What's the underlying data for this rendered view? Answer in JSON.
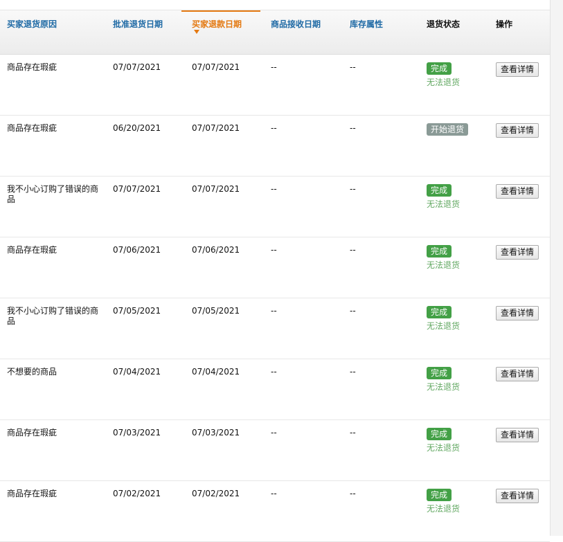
{
  "columns": {
    "reason": "买家退货原因",
    "approve_date": "批准退货日期",
    "refund_date": "买家退款日期",
    "receive_date": "商品接收日期",
    "stock_attr": "库存属性",
    "status": "退货状态",
    "action": "操作"
  },
  "rows": [
    {
      "reason": "商品存在瑕疵",
      "approve": "07/07/2021",
      "refund": "07/07/2021",
      "receive": "--",
      "stock": "--",
      "badge": "完成",
      "badge_type": "done",
      "sub": "无法退货",
      "action": "查看详情"
    },
    {
      "reason": "商品存在瑕疵",
      "approve": "06/20/2021",
      "refund": "07/07/2021",
      "receive": "--",
      "stock": "--",
      "badge": "开始退货",
      "badge_type": "start",
      "sub": "",
      "action": "查看详情"
    },
    {
      "reason": "我不小心订购了错误的商品",
      "approve": "07/07/2021",
      "refund": "07/07/2021",
      "receive": "--",
      "stock": "--",
      "badge": "完成",
      "badge_type": "done",
      "sub": "无法退货",
      "action": "查看详情"
    },
    {
      "reason": "商品存在瑕疵",
      "approve": "07/06/2021",
      "refund": "07/06/2021",
      "receive": "--",
      "stock": "--",
      "badge": "完成",
      "badge_type": "done",
      "sub": "无法退货",
      "action": "查看详情"
    },
    {
      "reason": "我不小心订购了错误的商品",
      "approve": "07/05/2021",
      "refund": "07/05/2021",
      "receive": "--",
      "stock": "--",
      "badge": "完成",
      "badge_type": "done",
      "sub": "无法退货",
      "action": "查看详情"
    },
    {
      "reason": "不想要的商品",
      "approve": "07/04/2021",
      "refund": "07/04/2021",
      "receive": "--",
      "stock": "--",
      "badge": "完成",
      "badge_type": "done",
      "sub": "无法退货",
      "action": "查看详情"
    },
    {
      "reason": "商品存在瑕疵",
      "approve": "07/03/2021",
      "refund": "07/03/2021",
      "receive": "--",
      "stock": "--",
      "badge": "完成",
      "badge_type": "done",
      "sub": "无法退货",
      "action": "查看详情"
    },
    {
      "reason": "商品存在瑕疵",
      "approve": "07/02/2021",
      "refund": "07/02/2021",
      "receive": "--",
      "stock": "--",
      "badge": "完成",
      "badge_type": "done",
      "sub": "无法退货",
      "action": "查看详情"
    }
  ],
  "colors": {
    "link_blue": "#1f6aa5",
    "sorted_orange": "#e47911",
    "badge_done": "#43a046",
    "badge_start": "#8a9a96",
    "substatus_green": "#62a862"
  },
  "icons": {
    "sort_indicator": "sort-desc-icon"
  }
}
